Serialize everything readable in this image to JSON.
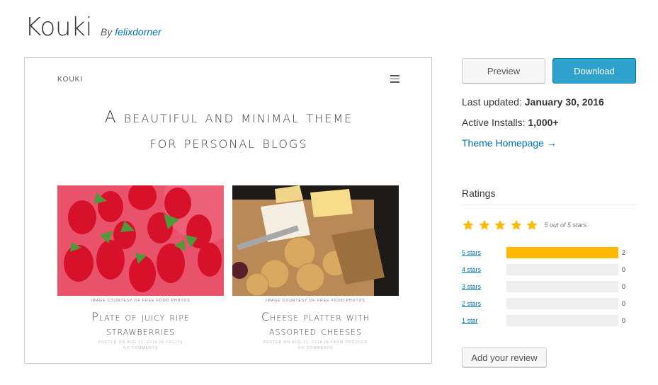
{
  "theme": {
    "name": "Kouki",
    "by_label": "By",
    "author": "felixdorner"
  },
  "screenshot": {
    "brand": "KOUKI",
    "heading_line1": "A beautiful and minimal theme",
    "heading_line2": "for personal blogs",
    "posts": [
      {
        "credit": "IMAGE COURTESY OF FREE FOOD PHOTOS",
        "title_line1": "Plate of juicy ripe",
        "title_line2": "strawberries",
        "meta_line1": "POSTED ON AUG 11, 2014 IN FRUITS",
        "meta_line2": "NO COMMENTS"
      },
      {
        "credit": "IMAGE COURTESY OF FREE FOOD PHOTOS",
        "title_line1": "Cheese platter with",
        "title_line2": "assorted cheeses",
        "meta_line1": "POSTED ON AUG 11, 2014 IN FARM PRODUCE",
        "meta_line2": "NO COMMENTS"
      }
    ]
  },
  "actions": {
    "preview": "Preview",
    "download": "Download"
  },
  "meta": {
    "last_updated_label": "Last updated:",
    "last_updated_value": "January 30, 2016",
    "active_installs_label": "Active Installs:",
    "active_installs_value": "1,000+",
    "homepage_link": "Theme Homepage →"
  },
  "ratings": {
    "heading": "Ratings",
    "summary": "5 out of 5 stars.",
    "star_color": "#ffb900",
    "rows": [
      {
        "label": "5 stars",
        "count": "2",
        "fraction": 1.0
      },
      {
        "label": "4 stars",
        "count": "0",
        "fraction": 0
      },
      {
        "label": "3 stars",
        "count": "0",
        "fraction": 0
      },
      {
        "label": "2 stars",
        "count": "0",
        "fraction": 0
      },
      {
        "label": "1 star",
        "count": "0",
        "fraction": 0
      }
    ],
    "add_review": "Add your review"
  }
}
